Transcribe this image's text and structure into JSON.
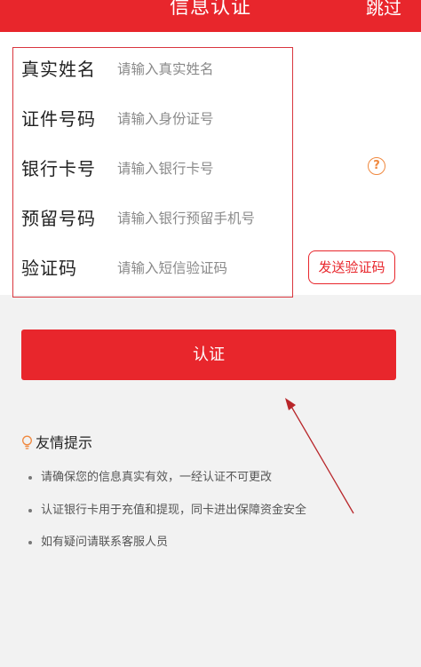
{
  "header": {
    "title": "信息认证",
    "skip_label": "跳过"
  },
  "form": {
    "fields": [
      {
        "label": "真实姓名",
        "placeholder": "请输入真实姓名"
      },
      {
        "label": "证件号码",
        "placeholder": "请输入身份证号"
      },
      {
        "label": "银行卡号",
        "placeholder": "请输入银行卡号"
      },
      {
        "label": "预留号码",
        "placeholder": "请输入银行预留手机号"
      },
      {
        "label": "验证码",
        "placeholder": "请输入短信验证码"
      }
    ],
    "help_icon_glyph": "?",
    "send_code_label": "发送验证码"
  },
  "submit_label": "认证",
  "tips": {
    "title": "友情提示",
    "items": [
      "请确保您的信息真实有效，一经认证不可更改",
      "认证银行卡用于充值和提现，同卡进出保障资金安全",
      "如有疑问请联系客服人员"
    ]
  },
  "colors": {
    "brand": "#e8262c",
    "accent": "#f0883e"
  },
  "icons": [
    "question-circle-icon",
    "lightbulb-icon"
  ]
}
